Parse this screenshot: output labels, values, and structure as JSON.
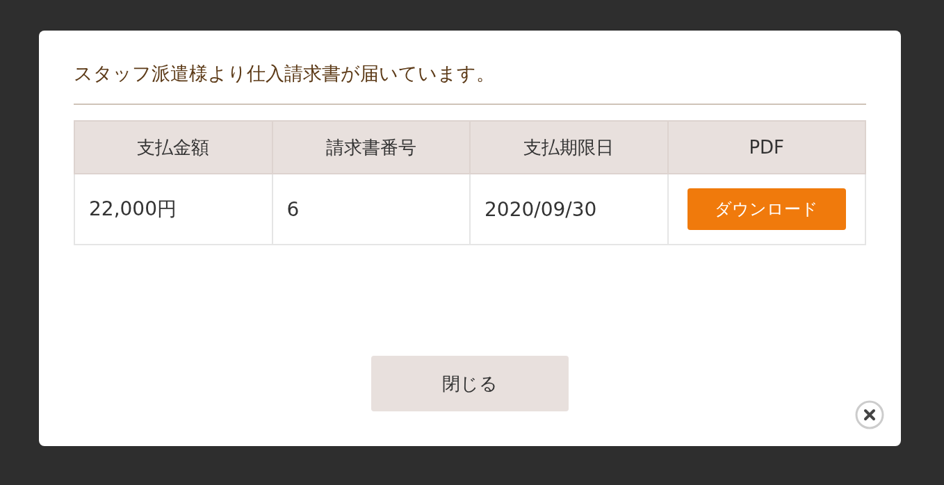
{
  "dialog": {
    "title": "スタッフ派遣様より仕入請求書が届いています。",
    "table": {
      "columns": [
        "支払金額",
        "請求書番号",
        "支払期限日",
        "PDF"
      ],
      "rows": [
        {
          "amount": "22,000円",
          "invoice_number": "6",
          "due_date": "2020/09/30",
          "pdf_button": "ダウンロード"
        }
      ]
    },
    "close_button": "閉じる"
  }
}
